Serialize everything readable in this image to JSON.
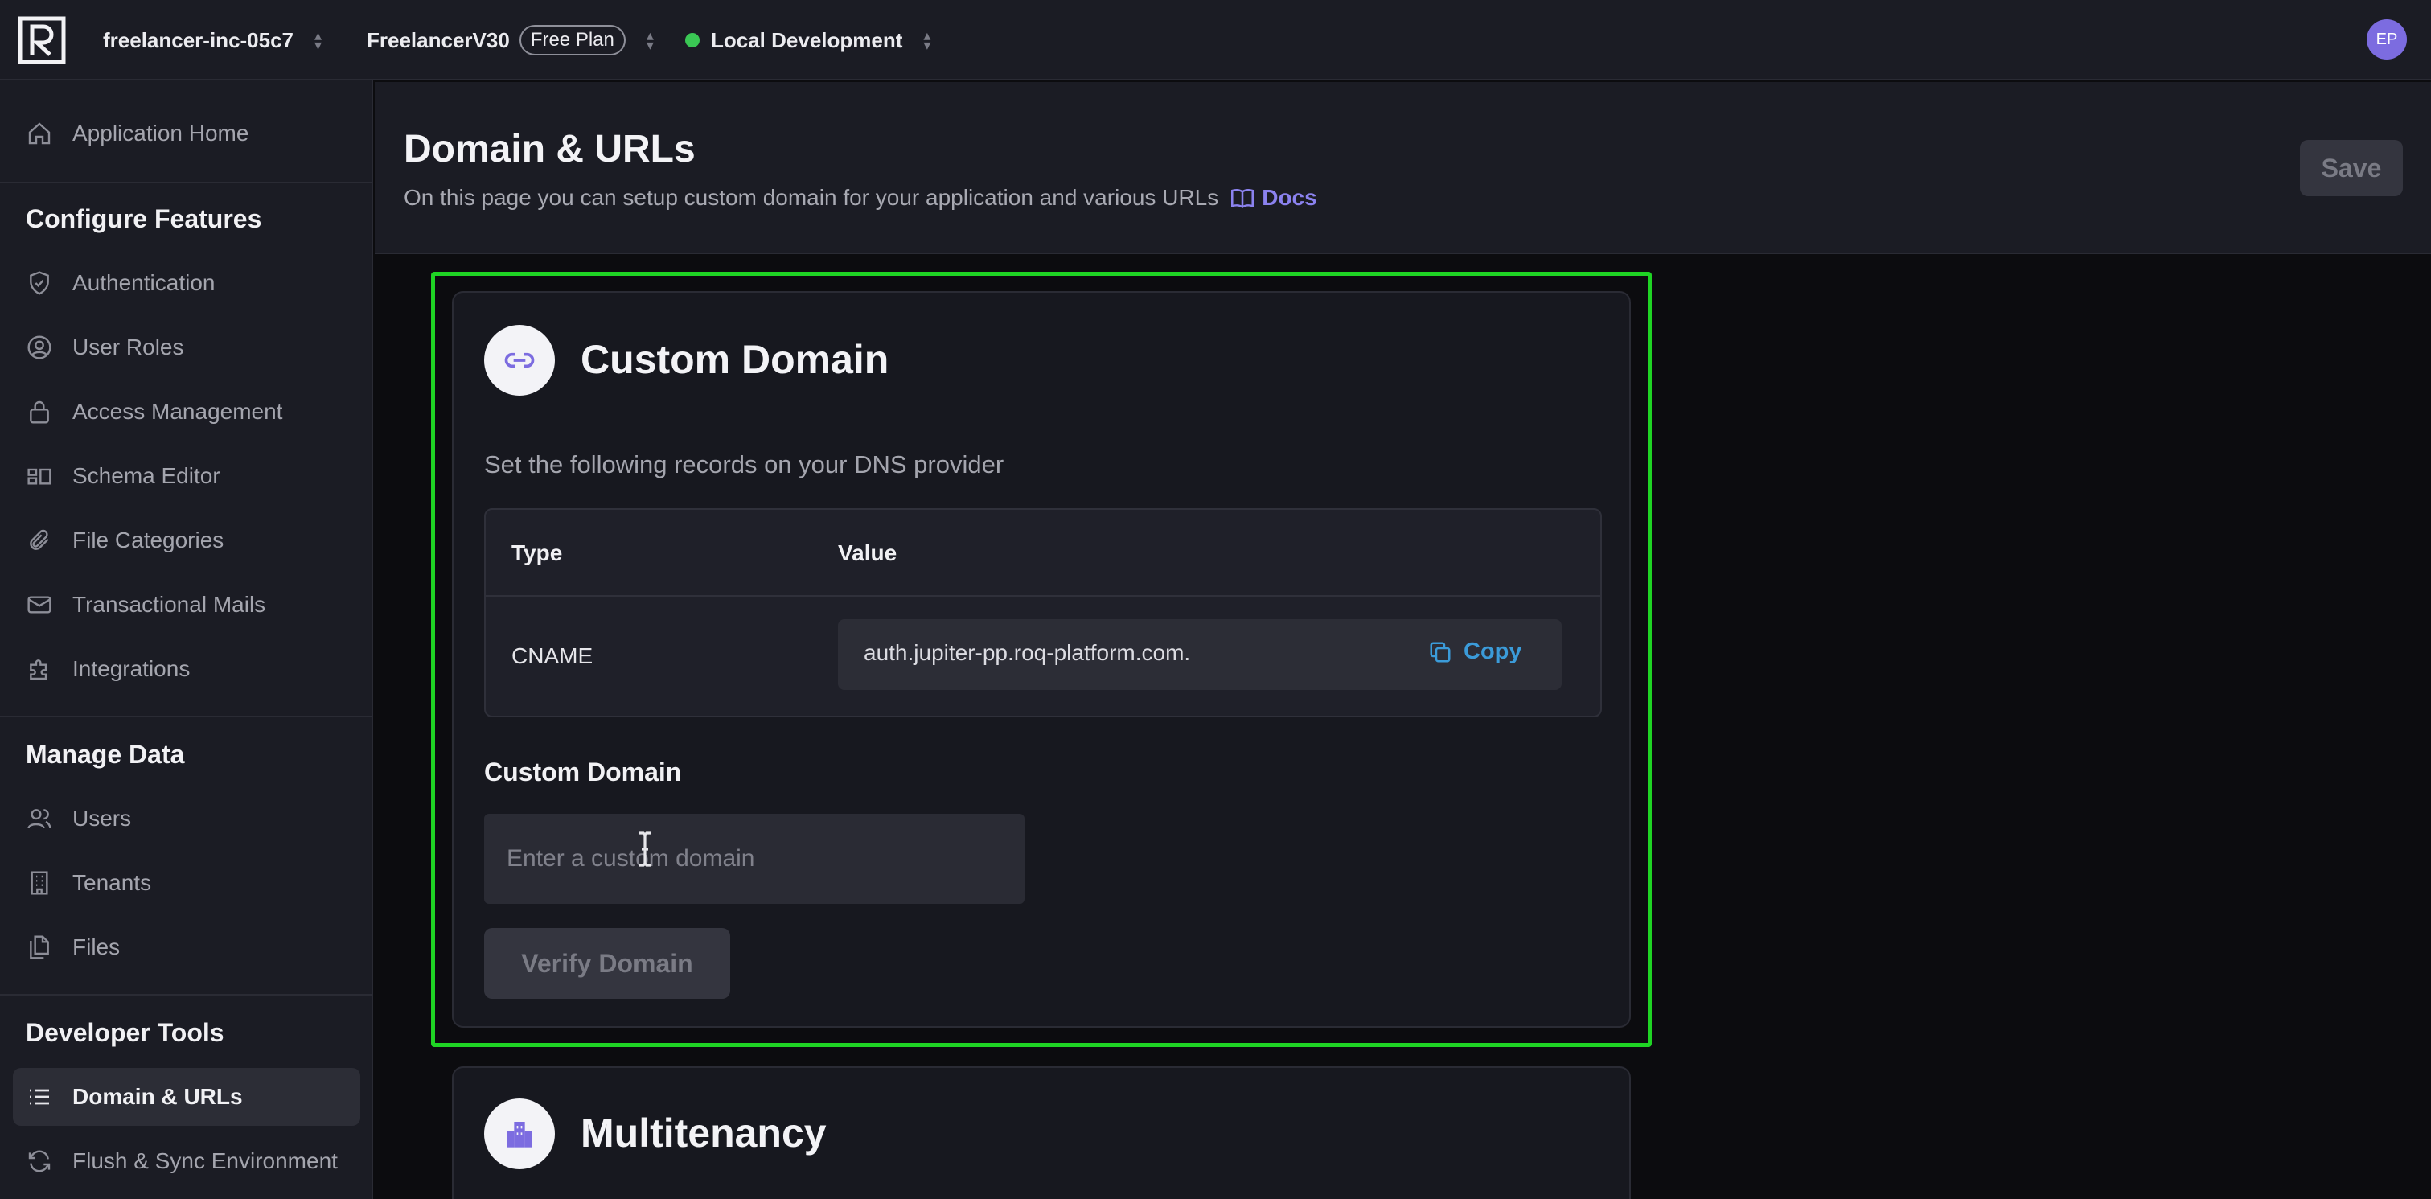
{
  "topbar": {
    "org": "freelancer-inc-05c7",
    "app": "FreelancerV30",
    "plan": "Free Plan",
    "environment": "Local Development",
    "env_status_color": "#3ac754",
    "avatar_initials": "EP"
  },
  "sidebar": {
    "home": "Application Home",
    "sections": {
      "configure": "Configure Features",
      "manage": "Manage Data",
      "developer": "Developer Tools"
    },
    "configure_items": [
      "Authentication",
      "User Roles",
      "Access Management",
      "Schema Editor",
      "File Categories",
      "Transactional Mails",
      "Integrations"
    ],
    "manage_items": [
      "Users",
      "Tenants",
      "Files"
    ],
    "developer_items": [
      "Domain & URLs",
      "Flush & Sync Environment"
    ],
    "active_item": "Domain & URLs"
  },
  "header": {
    "title": "Domain & URLs",
    "subtitle": "On this page you can setup custom domain for your application and various URLs",
    "docs_label": "Docs",
    "save_label": "Save"
  },
  "custom_domain": {
    "title": "Custom Domain",
    "instruction": "Set the following records on your DNS provider",
    "table": {
      "col_type": "Type",
      "col_value": "Value",
      "row_type": "CNAME",
      "row_value": "auth.jupiter-pp.roq-platform.com.",
      "copy_label": "Copy"
    },
    "field_label": "Custom Domain",
    "input_placeholder": "Enter a custom domain",
    "verify_label": "Verify Domain"
  },
  "multitenancy": {
    "title": "Multitenancy"
  },
  "colors": {
    "accent": "#8b82ef",
    "link_blue": "#3b9bd9",
    "highlight_green": "#1fd424"
  }
}
